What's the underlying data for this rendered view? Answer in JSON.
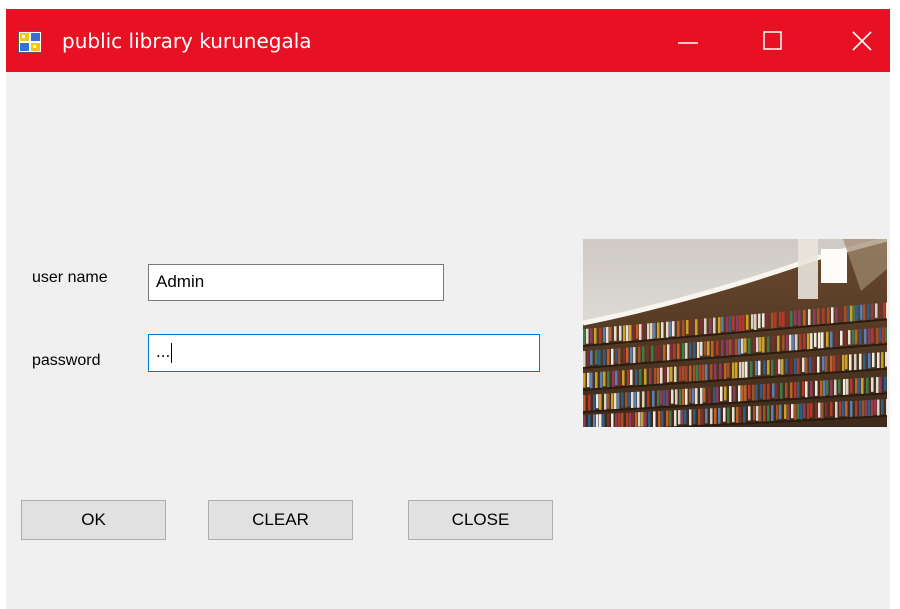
{
  "window": {
    "title": "public library kurunegala",
    "icon": "app-form-icon",
    "controls": [
      "minimize-icon",
      "maximize-icon",
      "close-icon"
    ],
    "titlebar_color": "#e81123",
    "background_color": "#f0f0f0"
  },
  "form": {
    "username_label": "user name",
    "username_value": "Admin",
    "password_label": "password",
    "password_value": "...",
    "focus_color": "#0078d7"
  },
  "buttons": {
    "ok": "OK",
    "clear": "CLEAR",
    "close": "CLOSE"
  },
  "image": {
    "subject": "library-bookshelves-image"
  }
}
